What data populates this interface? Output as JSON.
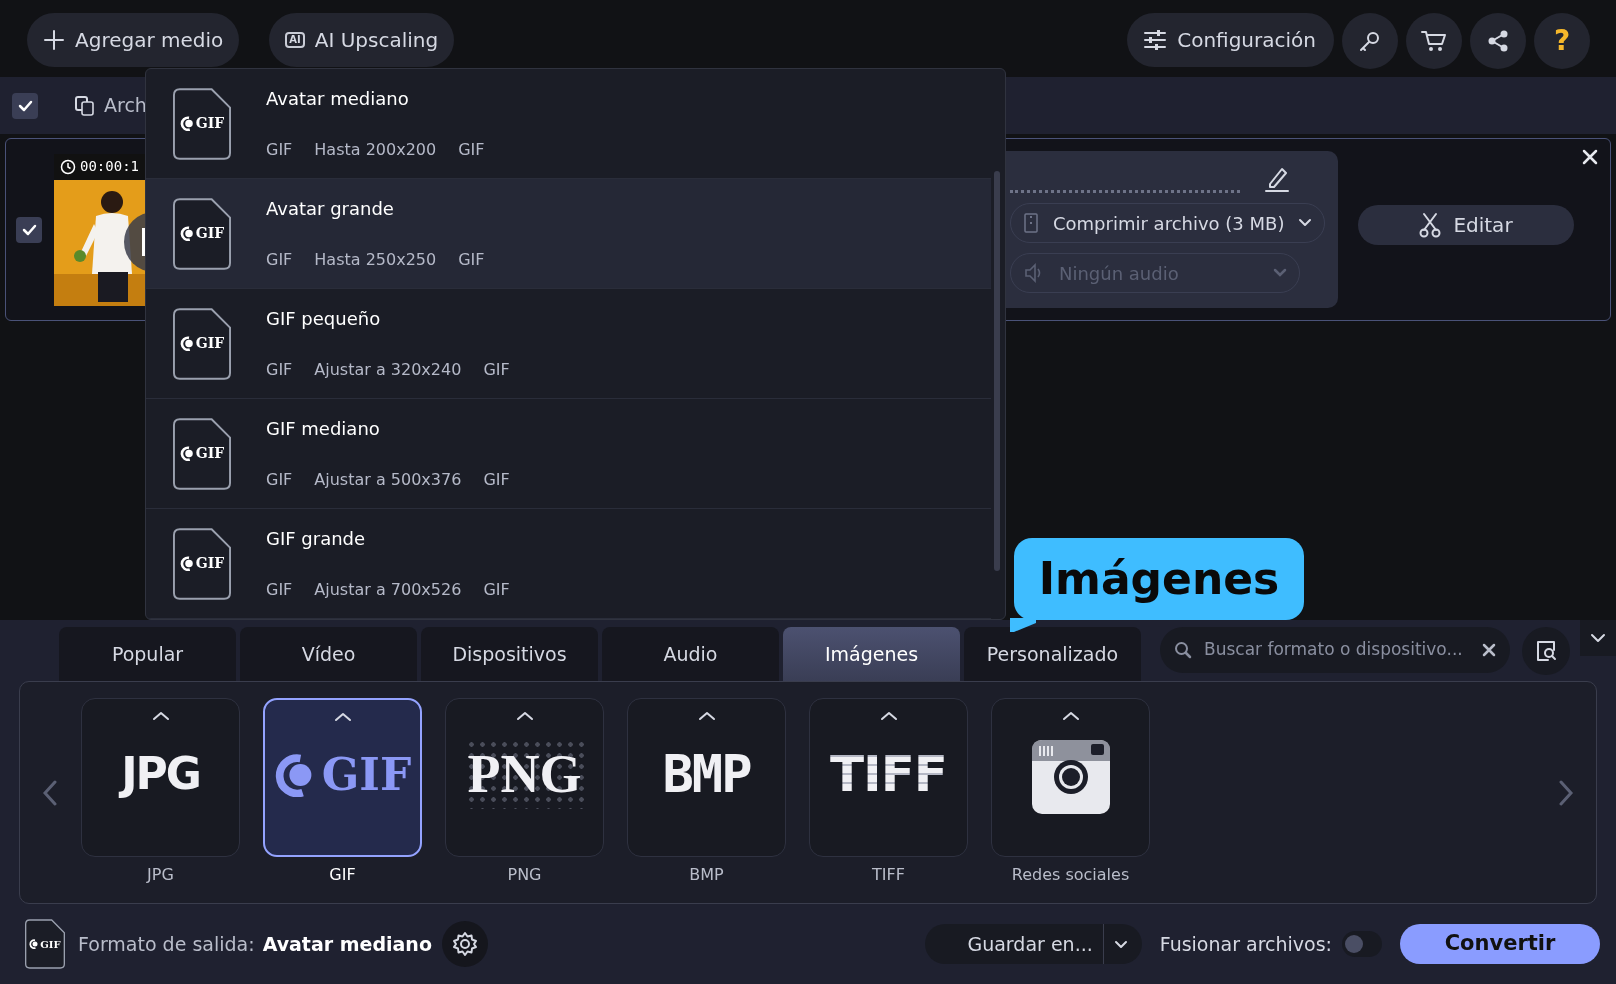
{
  "toolbar": {
    "add_media": "Agregar medio",
    "ai_upscaling": "AI Upscaling",
    "ai_badge": "AI",
    "settings": "Configuración",
    "help": "?"
  },
  "file_bar": {
    "checked": true,
    "label": "Arch"
  },
  "file": {
    "checked": true,
    "duration": "00:00:1",
    "compress": "Comprimir archivo (3 MB)",
    "audio": "Ningún audio",
    "audio_disabled": true,
    "edit": "Editar"
  },
  "preset_menu": {
    "items": [
      {
        "name": "Avatar mediano",
        "icon_text": "GIF",
        "format": "GIF",
        "size": "Hasta 200x200",
        "codec": "GIF",
        "selected": false
      },
      {
        "name": "Avatar grande",
        "icon_text": "GIF",
        "format": "GIF",
        "size": "Hasta 250x250",
        "codec": "GIF",
        "selected": true
      },
      {
        "name": "GIF pequeño",
        "icon_text": "GIF",
        "format": "GIF",
        "size": "Ajustar a 320x240",
        "codec": "GIF",
        "selected": false
      },
      {
        "name": "GIF mediano",
        "icon_text": "GIF",
        "format": "GIF",
        "size": "Ajustar a 500x376",
        "codec": "GIF",
        "selected": false
      },
      {
        "name": "GIF grande",
        "icon_text": "GIF",
        "format": "GIF",
        "size": "Ajustar a 700x526",
        "codec": "GIF",
        "selected": false
      }
    ]
  },
  "format_tabs": [
    {
      "label": "Popular",
      "selected": false
    },
    {
      "label": "Vídeo",
      "selected": false
    },
    {
      "label": "Dispositivos",
      "selected": false
    },
    {
      "label": "Audio",
      "selected": false
    },
    {
      "label": "Imágenes",
      "selected": true
    },
    {
      "label": "Personalizado",
      "selected": false
    }
  ],
  "search": {
    "placeholder": "Buscar formato o dispositivo..."
  },
  "callout": {
    "text": "Imágenes"
  },
  "formats": [
    {
      "kind": "sans-logo",
      "logo": "JPG",
      "label": "JPG",
      "selected": false
    },
    {
      "kind": "swirl-logo",
      "logo": "GIF",
      "label": "GIF",
      "selected": true
    },
    {
      "kind": "dotted-logo",
      "logo": "PNG",
      "label": "PNG",
      "selected": false
    },
    {
      "kind": "block-logo",
      "logo": "BMP",
      "label": "BMP",
      "selected": false
    },
    {
      "kind": "striped-logo",
      "logo": "TIFF",
      "label": "TIFF",
      "selected": false
    },
    {
      "kind": "camera",
      "label": "Redes sociales",
      "selected": false
    }
  ],
  "footer": {
    "icon_text": "GIF",
    "output_label": "Formato de salida:",
    "output_value": "Avatar mediano",
    "save": "Guardar en...",
    "merge_label": "Fusionar archivos:",
    "merge_on": false,
    "convert": "Convertir"
  }
}
